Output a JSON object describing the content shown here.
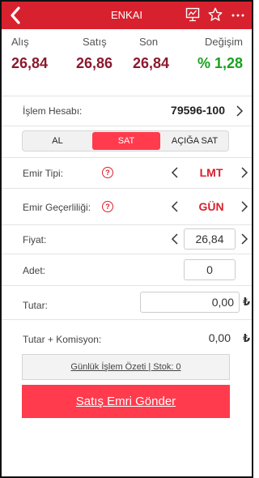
{
  "header": {
    "title": "ENKAI",
    "back_icon": "back-chevron-icon",
    "chart_icon": "chart-icon",
    "star_icon": "star-icon",
    "more_icon": "more-icon"
  },
  "quotes": [
    {
      "label": "Alış",
      "value": "26,84"
    },
    {
      "label": "Satış",
      "value": "26,86"
    },
    {
      "label": "Son",
      "value": "26,84"
    },
    {
      "label": "Değişim",
      "value": "% 1,28"
    }
  ],
  "account": {
    "label": "İşlem Hesabı:",
    "value": "79596-100"
  },
  "side_tabs": [
    {
      "label": "AL",
      "active": false
    },
    {
      "label": "SAT",
      "active": true
    },
    {
      "label": "AÇIĞA SAT",
      "active": false
    }
  ],
  "order_type": {
    "label": "Emir Tipi:",
    "value": "LMT"
  },
  "validity": {
    "label": "Emir Geçerliliği:",
    "value": "GÜN"
  },
  "price": {
    "label": "Fiyat:",
    "value": "26,84"
  },
  "quantity": {
    "label": "Adet:",
    "value": "0"
  },
  "amount": {
    "label": "Tutar:",
    "value": "0,00",
    "currency": "₺"
  },
  "amount_commission": {
    "label": "Tutar + Komisyon:",
    "value": "0,00",
    "currency": "₺"
  },
  "summary_link": "Günlük İşlem Özeti | Stok: 0",
  "submit_label": "Satış Emri Gönder",
  "colors": {
    "brand_red": "#d8212e",
    "button_red": "#ff3b4d",
    "quote_red": "#8b1a2e",
    "change_green": "#19a11f"
  }
}
